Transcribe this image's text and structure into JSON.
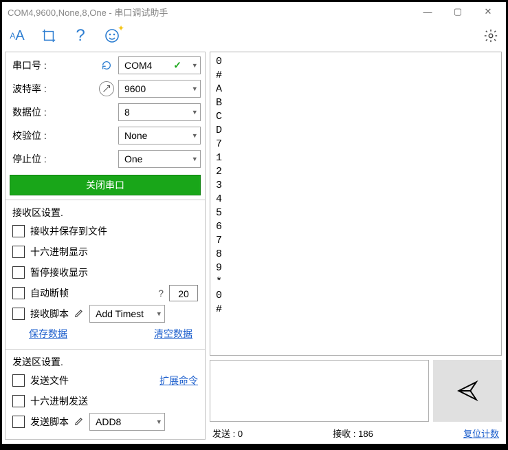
{
  "title": "COM4,9600,None,8,One - 串口调试助手",
  "win": {
    "min": "—",
    "max": "▢",
    "close": "✕"
  },
  "toolbar": {
    "font_icon": "AA",
    "crop_icon": "crop",
    "help_icon": "?",
    "smile_icon": "smile",
    "gear_icon": "gear"
  },
  "config": {
    "port_label": "串口号 :",
    "port_value": "COM4",
    "baud_label": "波特率 :",
    "baud_value": "9600",
    "databits_label": "数据位 :",
    "databits_value": "8",
    "parity_label": "校验位 :",
    "parity_value": "None",
    "stopbits_label": "停止位 :",
    "stopbits_value": "One",
    "close_btn": "关闭串口"
  },
  "rx_settings": {
    "header": "接收区设置.",
    "save_to_file": "接收并保存到文件",
    "hex_display": "十六进制显示",
    "pause_display": "暂停接收显示",
    "auto_break": "自动断帧",
    "auto_break_q": "?",
    "auto_break_val": "20",
    "rx_script": "接收脚本",
    "rx_script_val": "Add Timest",
    "save_data": "保存数据",
    "clear_data": "清空数据"
  },
  "tx_settings": {
    "header": "发送区设置.",
    "send_file": "发送文件",
    "ext_cmd": "扩展命令",
    "hex_send": "十六进制发送",
    "tx_script": "发送脚本",
    "tx_script_val": "ADD8"
  },
  "rx_data": "0\n#\nA\nB\nC\nD\n7\n1\n2\n3\n4\n5\n6\n7\n8\n9\n*\n0\n#",
  "status": {
    "tx_label": "发送 :",
    "tx_count": "0",
    "rx_label": "接收 :",
    "rx_count": "186",
    "reset": "复位计数"
  }
}
